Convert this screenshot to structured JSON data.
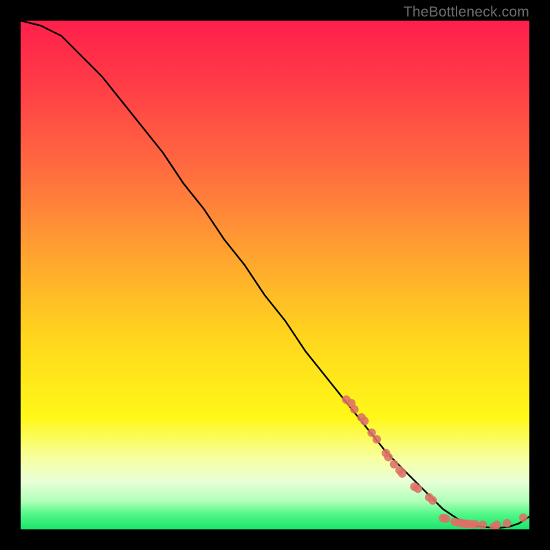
{
  "watermark": "TheBottleneck.com",
  "colors": {
    "background": "#000000",
    "curve": "#000000",
    "points": "#dd6f66",
    "gradient_stops": [
      {
        "offset": 0.0,
        "color": "#ff1f4c"
      },
      {
        "offset": 0.12,
        "color": "#ff3b47"
      },
      {
        "offset": 0.3,
        "color": "#ff6e3f"
      },
      {
        "offset": 0.47,
        "color": "#ffa62f"
      },
      {
        "offset": 0.62,
        "color": "#ffd51d"
      },
      {
        "offset": 0.78,
        "color": "#fff818"
      },
      {
        "offset": 0.86,
        "color": "#f7ffa0"
      },
      {
        "offset": 0.905,
        "color": "#e9ffd7"
      },
      {
        "offset": 0.945,
        "color": "#aeffb8"
      },
      {
        "offset": 0.97,
        "color": "#52f787"
      },
      {
        "offset": 1.0,
        "color": "#19e56c"
      }
    ]
  },
  "chart_data": {
    "type": "line",
    "title": "",
    "xlabel": "",
    "ylabel": "",
    "xlim": [
      0,
      100
    ],
    "ylim": [
      0,
      100
    ],
    "series": [
      {
        "name": "curve",
        "x": [
          0,
          4,
          8,
          12,
          16,
          20,
          24,
          28,
          32,
          36,
          40,
          44,
          48,
          52,
          56,
          60,
          64,
          68,
          72,
          76,
          80,
          83,
          86,
          88,
          90,
          92,
          94,
          96,
          98,
          100
        ],
        "y": [
          100,
          99,
          97,
          93,
          89,
          84,
          79,
          74,
          68,
          63,
          57,
          52,
          46,
          41,
          35,
          30,
          25,
          20,
          15,
          11,
          7,
          4,
          2,
          1,
          0.6,
          0.4,
          0.3,
          0.5,
          1.2,
          2.5
        ]
      }
    ],
    "points": [
      {
        "x": 64.0,
        "y": 25.5
      },
      {
        "x": 65.0,
        "y": 24.8
      },
      {
        "x": 65.6,
        "y": 23.6
      },
      {
        "x": 67.0,
        "y": 22.0
      },
      {
        "x": 67.6,
        "y": 21.3
      },
      {
        "x": 69.0,
        "y": 19.0
      },
      {
        "x": 70.0,
        "y": 17.7
      },
      {
        "x": 71.8,
        "y": 15.0
      },
      {
        "x": 72.3,
        "y": 14.2
      },
      {
        "x": 73.4,
        "y": 12.8
      },
      {
        "x": 74.5,
        "y": 11.6
      },
      {
        "x": 75.0,
        "y": 11.0
      },
      {
        "x": 77.4,
        "y": 8.4
      },
      {
        "x": 78.1,
        "y": 8.0
      },
      {
        "x": 80.3,
        "y": 6.3
      },
      {
        "x": 81.0,
        "y": 5.7
      },
      {
        "x": 83.0,
        "y": 2.2
      },
      {
        "x": 83.6,
        "y": 2.1
      },
      {
        "x": 85.3,
        "y": 1.5
      },
      {
        "x": 86.1,
        "y": 1.3
      },
      {
        "x": 86.8,
        "y": 1.2
      },
      {
        "x": 87.4,
        "y": 1.1
      },
      {
        "x": 88.0,
        "y": 1.1
      },
      {
        "x": 88.8,
        "y": 1.0
      },
      {
        "x": 89.4,
        "y": 1.0
      },
      {
        "x": 90.8,
        "y": 0.9
      },
      {
        "x": 93.0,
        "y": 0.5
      },
      {
        "x": 93.6,
        "y": 0.9
      },
      {
        "x": 95.6,
        "y": 1.2
      },
      {
        "x": 98.8,
        "y": 2.3
      }
    ]
  }
}
